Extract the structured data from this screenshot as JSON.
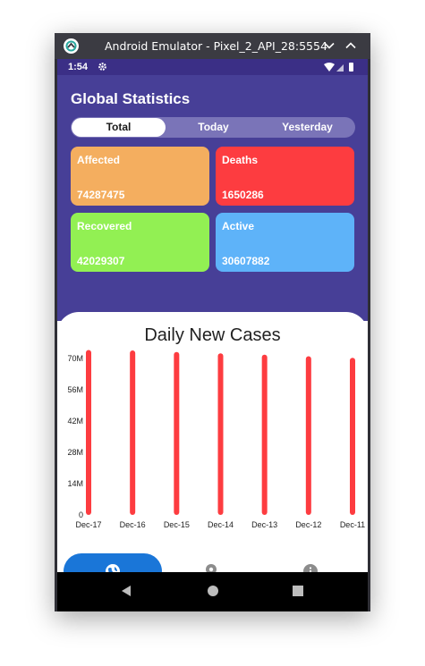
{
  "window": {
    "title": "Android Emulator - Pixel_2_API_28:5554"
  },
  "status_bar": {
    "time": "1:54"
  },
  "header": {
    "title": "Global Statistics",
    "tabs": [
      "Total",
      "Today",
      "Yesterday"
    ],
    "selected_tab": "Total"
  },
  "cards": [
    {
      "label": "Affected",
      "value": "74287475",
      "color": "#f4ae5f"
    },
    {
      "label": "Deaths",
      "value": "1650286",
      "color": "#fd3c40"
    },
    {
      "label": "Recovered",
      "value": "42029307",
      "color": "#92f053"
    },
    {
      "label": "Active",
      "value": "30607882",
      "color": "#5eb3f9"
    }
  ],
  "chart_data": {
    "type": "bar",
    "title": "Daily New Cases",
    "categories": [
      "Dec-17",
      "Dec-16",
      "Dec-15",
      "Dec-14",
      "Dec-13",
      "Dec-12",
      "Dec-11"
    ],
    "values": [
      73800000,
      73600000,
      72900000,
      72300000,
      71700000,
      71000000,
      70300000
    ],
    "ylim": [
      0,
      70000000
    ],
    "yticks": [
      "0",
      "14M",
      "28M",
      "42M",
      "56M",
      "70M"
    ],
    "bar_color": "#fd3c40"
  },
  "bottom_nav": {
    "items": [
      "globe-icon",
      "location-pin-icon",
      "info-icon"
    ],
    "active": "globe-icon",
    "active_color": "#1a76d8"
  },
  "colors": {
    "header_bg": "#473f97",
    "status_bar_bg": "#3b2f86"
  }
}
